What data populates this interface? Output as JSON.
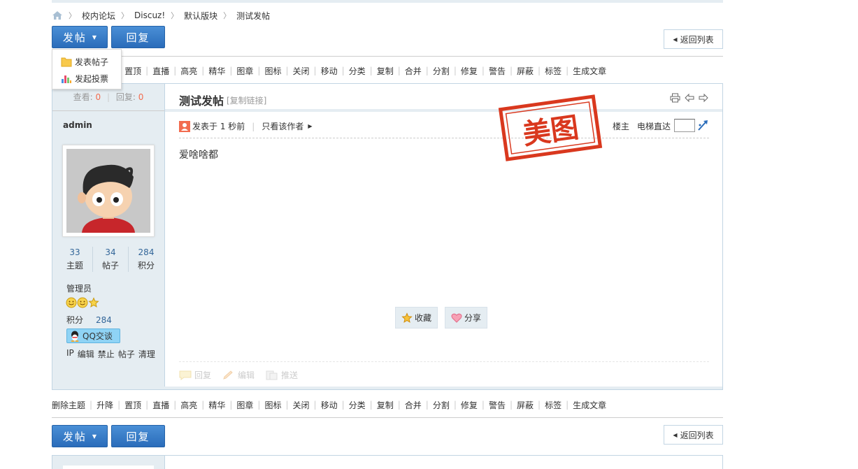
{
  "breadcrumb": {
    "home_icon": "home-icon",
    "items": [
      "校内论坛",
      "Discuz!",
      "默认版块",
      "测试发帖"
    ]
  },
  "buttons": {
    "post": "发帖",
    "reply": "回复",
    "back": "返回列表"
  },
  "dropdown": {
    "items": [
      {
        "label": "发表帖子",
        "icon": "folder-icon"
      },
      {
        "label": "发起投票",
        "icon": "poll-chart-icon"
      }
    ]
  },
  "modbar": {
    "items": [
      "删除主题",
      "升降",
      "置顶",
      "直播",
      "高亮",
      "精华",
      "图章",
      "图标",
      "关闭",
      "移动",
      "分类",
      "复制",
      "合并",
      "分割",
      "修复",
      "警告",
      "屏蔽",
      "标签",
      "生成文章"
    ]
  },
  "thread_stats": {
    "views_label": "查看:",
    "views": "0",
    "replies_label": "回复:",
    "replies": "0"
  },
  "author": {
    "name": "admin",
    "stats": [
      {
        "value": "33",
        "label": "主题"
      },
      {
        "value": "34",
        "label": "帖子"
      },
      {
        "value": "284",
        "label": "积分"
      }
    ],
    "role": "管理员",
    "score_label": "积分",
    "score_value": "284",
    "qq_label": "QQ交谈",
    "admin_links": [
      "IP",
      "编辑",
      "禁止",
      "帖子",
      "清理"
    ]
  },
  "post": {
    "title": "测试发帖",
    "copy_link": "[复制链接]",
    "posted_prefix": "发表于",
    "posted_time": "1 秒前",
    "only_author": "只看该作者",
    "floor": "楼主",
    "elevator": "电梯直达",
    "content": "爱啥啥都",
    "favorite": "收藏",
    "share": "分享",
    "foot_actions": [
      "回复",
      "编辑",
      "推送"
    ],
    "stamp_text": "美图"
  },
  "colors": {
    "accent": "#2a6cba",
    "side_bg": "#e5edf2",
    "border": "#c2d5e3",
    "stamp": "#d9381e",
    "count": "#f26c4f"
  }
}
